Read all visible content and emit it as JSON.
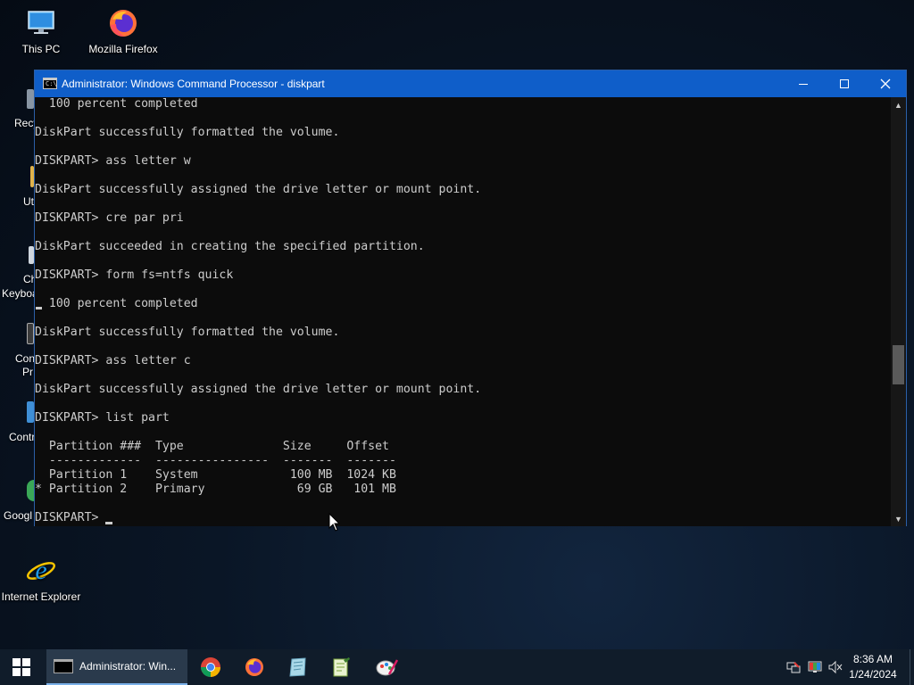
{
  "desktop": {
    "icons": [
      {
        "label": "This PC",
        "icon": "computer-icon"
      },
      {
        "label": "Mozilla Firefox",
        "icon": "firefox-icon"
      },
      {
        "label": "Internet Explorer",
        "icon": "internet-explorer-icon"
      }
    ],
    "partial_labels": [
      "Recy",
      "Ut",
      "Ch",
      "Keyboa",
      "Con",
      "Pr",
      "Contr",
      "Googl"
    ]
  },
  "window": {
    "title": "Administrator: Windows Command Processor - diskpart",
    "icon": "cmd-icon",
    "title_icon_text": "C:\\",
    "controls": {
      "minimize": "minimize-icon",
      "maximize": "maximize-icon",
      "close": "close-icon"
    }
  },
  "console": {
    "lines": [
      "  100 percent completed",
      "",
      "DiskPart successfully formatted the volume.",
      "",
      "DISKPART> ass letter w",
      "",
      "DiskPart successfully assigned the drive letter or mount point.",
      "",
      "DISKPART> cre par pri",
      "",
      "DiskPart succeeded in creating the specified partition.",
      "",
      "DISKPART> form fs=ntfs quick",
      "",
      "  100 percent completed",
      "",
      "DiskPart successfully formatted the volume.",
      "",
      "DISKPART> ass letter c",
      "",
      "DiskPart successfully assigned the drive letter or mount point.",
      "",
      "DISKPART> list part",
      "",
      "  Partition ###  Type              Size     Offset",
      "  -------------  ----------------  -------  -------",
      "  Partition 1    System             100 MB  1024 KB",
      "* Partition 2    Primary             69 GB   101 MB",
      ""
    ],
    "prompt": "DISKPART> "
  },
  "taskbar": {
    "start_icon": "windows-start-icon",
    "active_task": {
      "label": "Administrator: Win...",
      "icon": "cmd-icon"
    },
    "pinned": [
      {
        "name": "Google Chrome",
        "icon": "chrome-icon"
      },
      {
        "name": "Mozilla Firefox",
        "icon": "firefox-icon"
      },
      {
        "name": "Notepad++",
        "icon": "notepadpp-icon"
      },
      {
        "name": "Notepad",
        "icon": "notepad-icon"
      },
      {
        "name": "Paint",
        "icon": "paint-icon"
      }
    ],
    "tray": {
      "icons": [
        "network-icon",
        "display-icon",
        "volume-muted-icon"
      ],
      "time": "8:36 AM",
      "date": "1/24/2024"
    }
  },
  "colors": {
    "titlebar": "#0f5ec9",
    "console_bg": "#0c0c0c",
    "console_fg": "#cccccc",
    "taskbar": "#101c2a"
  }
}
